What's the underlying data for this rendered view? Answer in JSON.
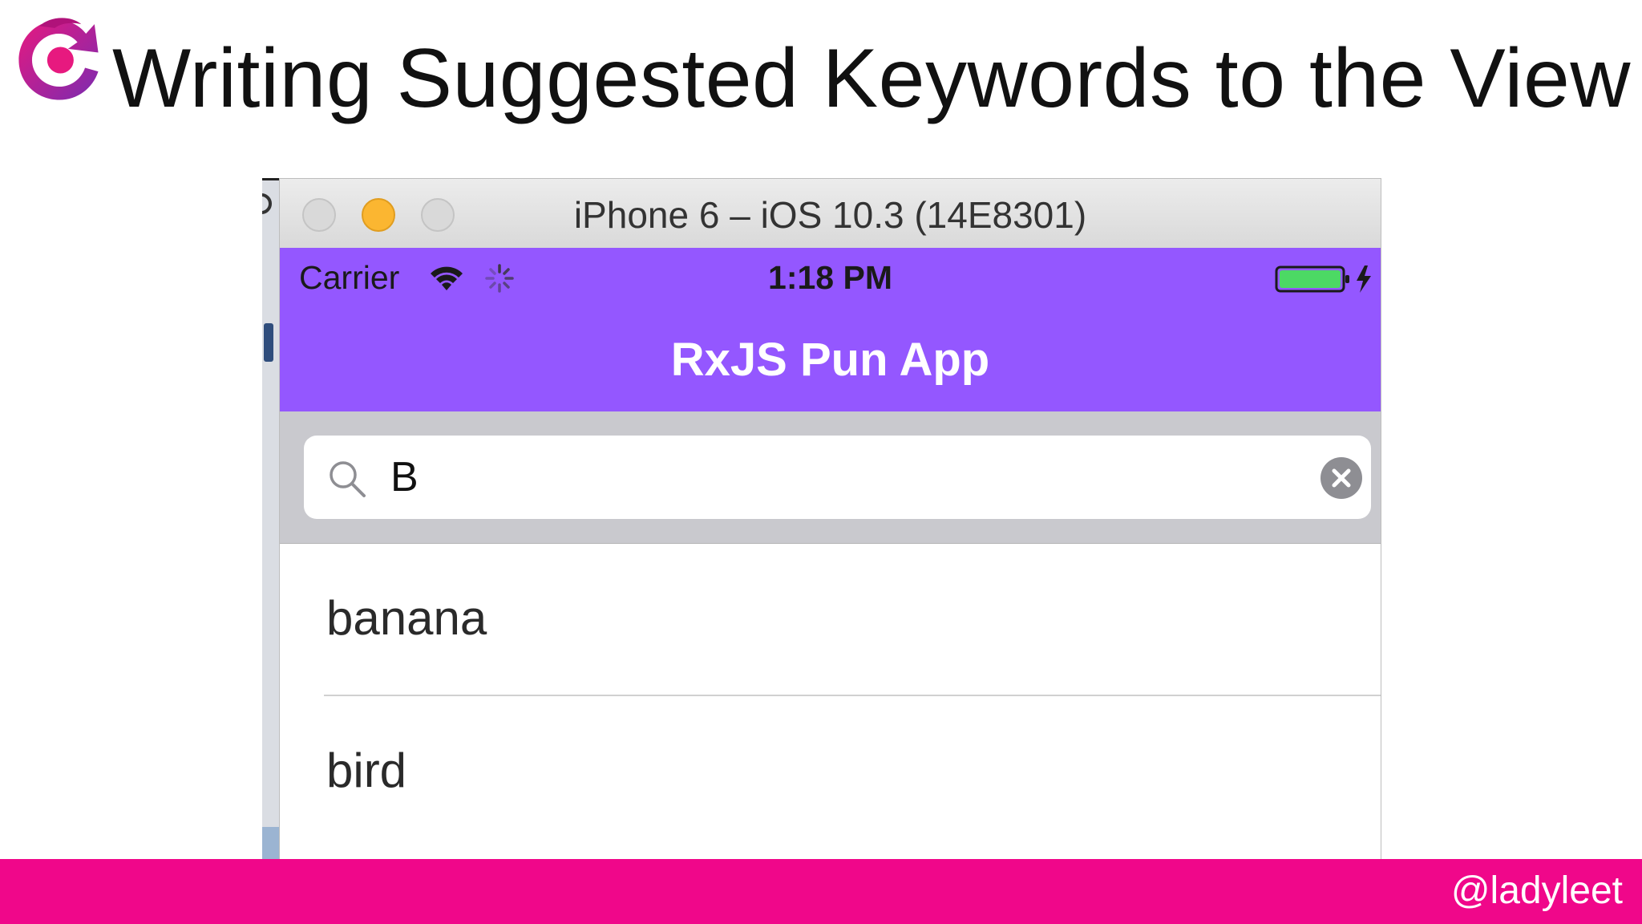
{
  "slide": {
    "title": "Writing Suggested Keywords to the View",
    "footer_handle": "@ladyleet",
    "logo_icon": "rxjs-logo-icon",
    "accent_color": "#f0078a"
  },
  "simulator": {
    "window_title": "iPhone 6 – iOS 10.3 (14E8301)",
    "status": {
      "carrier": "Carrier",
      "time": "1:18 PM",
      "battery_color": "#4cd964"
    },
    "nav_title": "RxJS Pun App",
    "nav_color": "#9457ff",
    "search": {
      "value": "B"
    },
    "results": [
      {
        "label": "banana"
      },
      {
        "label": "bird"
      }
    ]
  }
}
